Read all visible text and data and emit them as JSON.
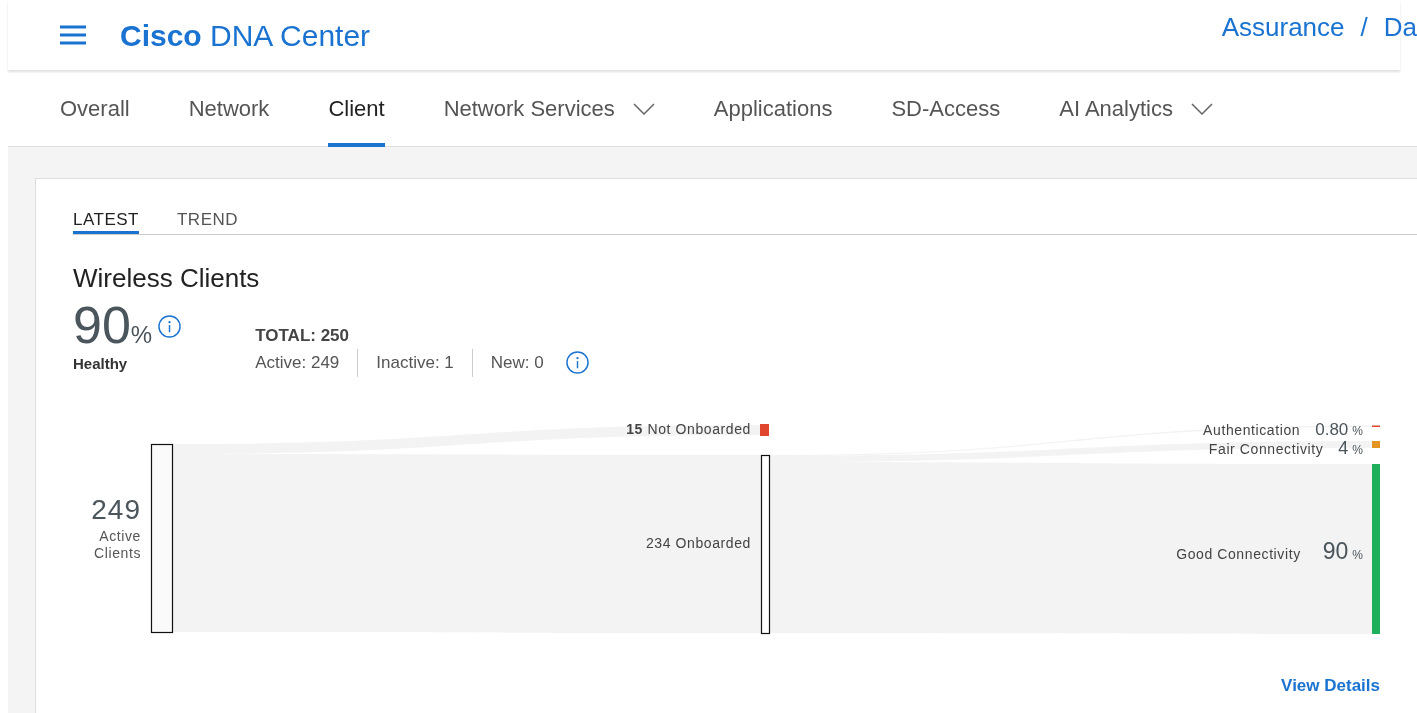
{
  "header": {
    "brand_bold": "Cisco",
    "brand_rest": "DNA Center",
    "breadcrumb": [
      "Assurance",
      "Da"
    ],
    "separator": "/"
  },
  "tabs": [
    {
      "label": "Overall",
      "selected": false,
      "has_menu": false
    },
    {
      "label": "Network",
      "selected": false,
      "has_menu": false
    },
    {
      "label": "Client",
      "selected": true,
      "has_menu": false
    },
    {
      "label": "Network Services",
      "selected": false,
      "has_menu": true
    },
    {
      "label": "Applications",
      "selected": false,
      "has_menu": false
    },
    {
      "label": "SD-Access",
      "selected": false,
      "has_menu": false
    },
    {
      "label": "AI Analytics",
      "selected": false,
      "has_menu": true
    }
  ],
  "card": {
    "view_tabs": [
      {
        "label": "LATEST",
        "selected": true
      },
      {
        "label": "TREND",
        "selected": false
      }
    ],
    "title": "Wireless Clients",
    "health": {
      "value": "90",
      "unit": "%",
      "label": "Healthy"
    },
    "total": "TOTAL: 250",
    "counts": [
      "Active: 249",
      "Inactive: 1",
      "New: 0"
    ],
    "flow": {
      "source": {
        "count": "249",
        "label_lines": [
          "Active",
          "Clients"
        ]
      },
      "middle": [
        {
          "kind": "failed",
          "label": "**15** Not Onboarded",
          "color": "#e0452e"
        },
        {
          "kind": "passed",
          "label": "234 Onboarded"
        }
      ],
      "outcomes": [
        {
          "label": "Authentication",
          "value": "0.80",
          "unit": "%",
          "color": "#e0452e"
        },
        {
          "label": "Fair Connectivity",
          "value": "4",
          "unit": "%",
          "color": "#e39423"
        },
        {
          "label": "Good Connectivity",
          "value": "90",
          "unit": "%",
          "color": "#1fae5b"
        }
      ]
    },
    "link": "View Details"
  }
}
